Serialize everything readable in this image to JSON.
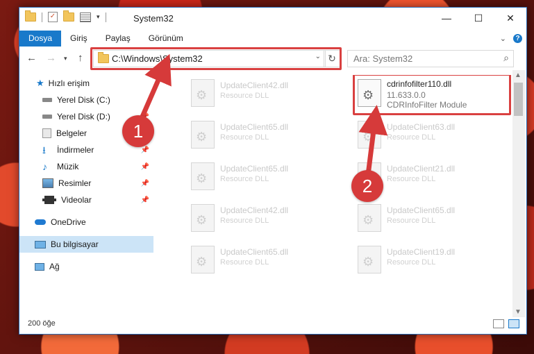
{
  "window": {
    "title": "System32",
    "controls": {
      "minimize": "—",
      "maximize": "☐",
      "close": "✕"
    }
  },
  "ribbon": {
    "tabs": [
      "Dosya",
      "Giriş",
      "Paylaş",
      "Görünüm"
    ],
    "active_tab": "Dosya"
  },
  "address": {
    "path": "C:\\Windows\\System32",
    "search_placeholder": "Ara: System32"
  },
  "sidebar": {
    "items": [
      {
        "label": "Hızlı erişim",
        "icon": "star-icon",
        "pinned": false
      },
      {
        "label": "Yerel Disk (C:)",
        "icon": "drive-icon",
        "pinned": false
      },
      {
        "label": "Yerel Disk (D:)",
        "icon": "drive-icon",
        "pinned": true
      },
      {
        "label": "Belgeler",
        "icon": "documents-icon",
        "pinned": true
      },
      {
        "label": "İndirmeler",
        "icon": "downloads-icon",
        "pinned": true
      },
      {
        "label": "Müzik",
        "icon": "music-icon",
        "pinned": true
      },
      {
        "label": "Resimler",
        "icon": "pictures-icon",
        "pinned": true
      },
      {
        "label": "Videolar",
        "icon": "videos-icon",
        "pinned": true
      },
      {
        "label": "OneDrive",
        "icon": "cloud-icon",
        "pinned": false
      },
      {
        "label": "Bu bilgisayar",
        "icon": "computer-icon",
        "pinned": false
      },
      {
        "label": "Ağ",
        "icon": "network-icon",
        "pinned": false
      }
    ],
    "selected": "Bu bilgisayar"
  },
  "files": [
    {
      "name": "UpdateClient42.dll",
      "type": "Resource DLL"
    },
    {
      "name": "cdrinfofilter110.dll",
      "version": "11.633.0.0",
      "description": "CDRInfoFilter Module"
    },
    {
      "name": "UpdateClient65.dll",
      "type": "Resource DLL"
    },
    {
      "name": "UpdateClient63.dll",
      "type": "Resource DLL"
    },
    {
      "name": "UpdateClient65.dll",
      "type": "Resource DLL"
    },
    {
      "name": "UpdateClient21.dll",
      "type": "Resource DLL"
    },
    {
      "name": "UpdateClient42.dll",
      "type": "Resource DLL"
    },
    {
      "name": "UpdateClient65.dll",
      "type": "Resource DLL"
    },
    {
      "name": "UpdateClient65.dll",
      "type": "Resource DLL"
    },
    {
      "name": "UpdateClient19.dll",
      "type": "Resource DLL"
    }
  ],
  "status": {
    "count": "200 öğe"
  },
  "callouts": [
    "1",
    "2"
  ],
  "colors": {
    "accent": "#1979ca",
    "highlight": "#d94040"
  }
}
